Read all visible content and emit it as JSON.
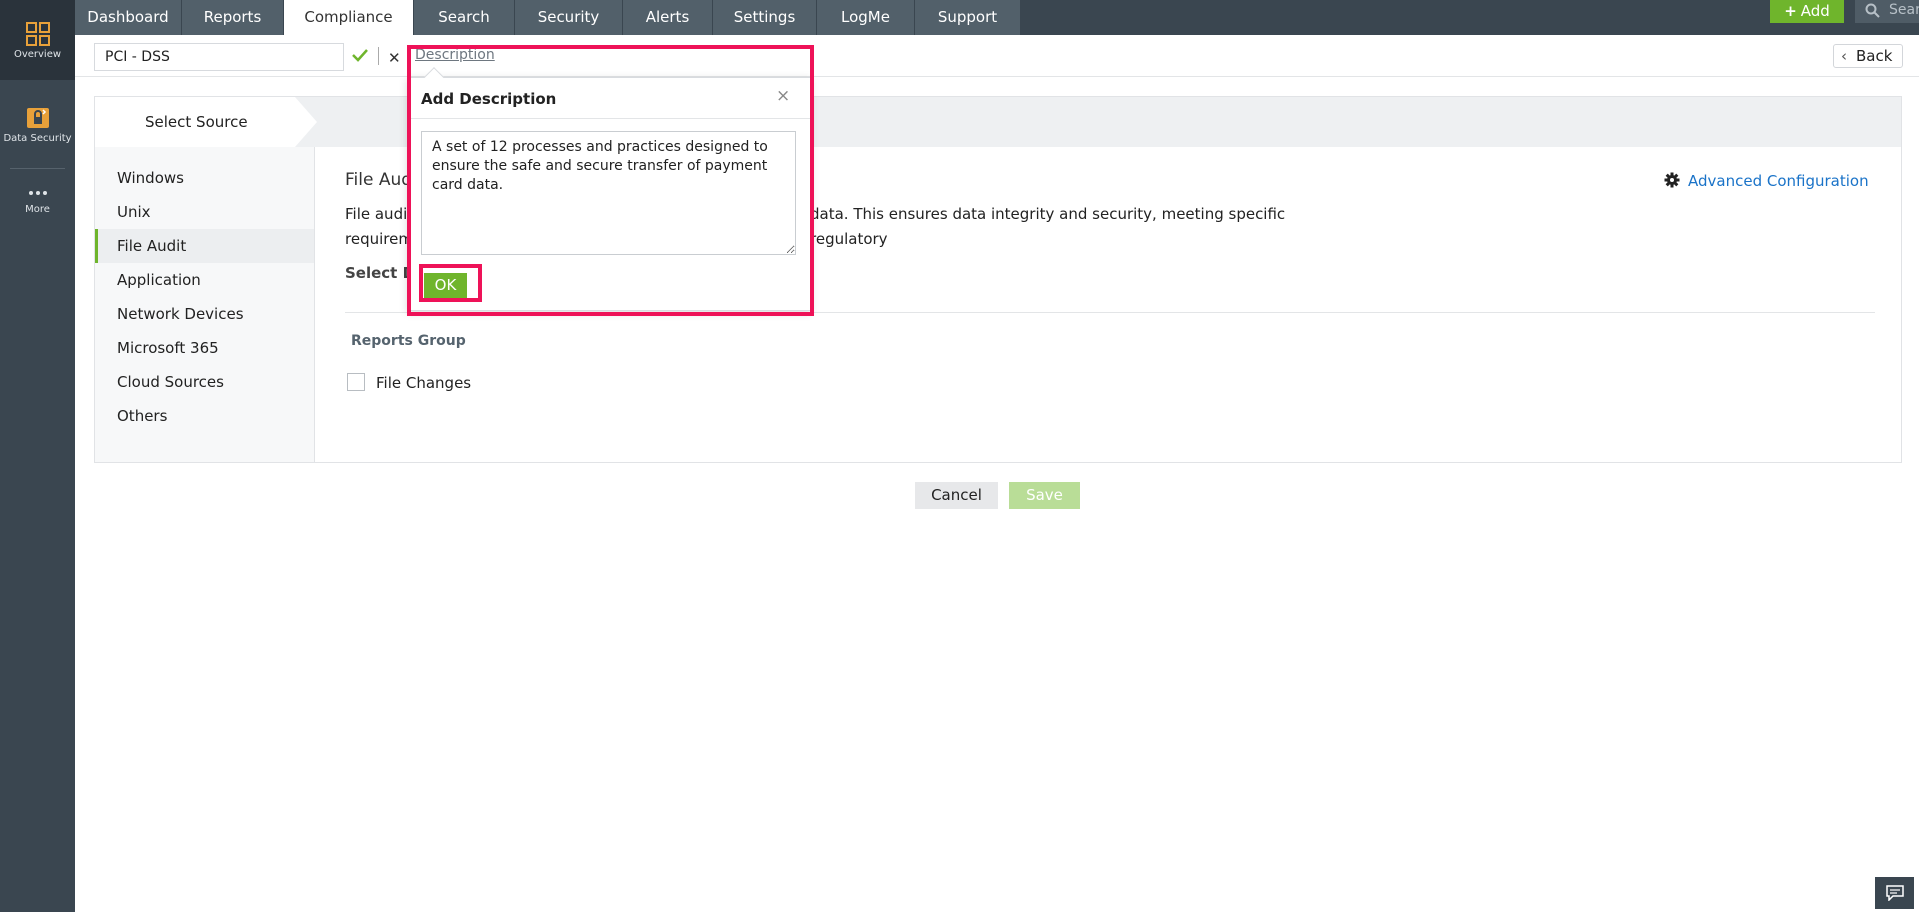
{
  "rail": {
    "items": [
      {
        "label": "Overview",
        "icon": "grid-icon"
      },
      {
        "label": "Data Security",
        "icon": "data-security-icon"
      },
      {
        "label": "More",
        "icon": "more-dots-icon"
      }
    ]
  },
  "topnav": {
    "tabs": [
      {
        "label": "Dashboard"
      },
      {
        "label": "Reports"
      },
      {
        "label": "Compliance"
      },
      {
        "label": "Search"
      },
      {
        "label": "Security"
      },
      {
        "label": "Alerts"
      },
      {
        "label": "Settings"
      },
      {
        "label": "LogMe"
      },
      {
        "label": "Support"
      }
    ],
    "active_tab": "Compliance",
    "add_label": "Add",
    "search_placeholder": "Search"
  },
  "namebar": {
    "name_value": "PCI - DSS",
    "description_link": "Description",
    "back_label": "Back"
  },
  "wizard": {
    "step_label": "Select Source"
  },
  "sources": {
    "items": [
      "Windows",
      "Unix",
      "File Audit",
      "Application",
      "Network Devices",
      "Microsoft 365",
      "Cloud Sources",
      "Others"
    ],
    "selected": "File Audit"
  },
  "content": {
    "title_visible": "File Aud",
    "desc_line1_left": "File audit",
    "desc_line1_right": "data. This ensures data integrity and security, meeting specific regulatory",
    "desc_line2_left": "requirem",
    "select_label_visible": "Select D",
    "advanced_config": "Advanced Configuration",
    "reports_group_label": "Reports Group",
    "file_changes_label": "File Changes"
  },
  "actions": {
    "cancel_label": "Cancel",
    "save_label": "Save"
  },
  "modal": {
    "title": "Add Description",
    "close_symbol": "×",
    "description_text": "A set of 12 processes and practices designed to ensure the safe and secure transfer of payment card data.",
    "ok_label": "OK"
  },
  "colors": {
    "accent_green": "#6fb52c",
    "nav_dark": "#3a4650",
    "link_blue": "#1a73c8",
    "highlight": "#ee1258"
  }
}
